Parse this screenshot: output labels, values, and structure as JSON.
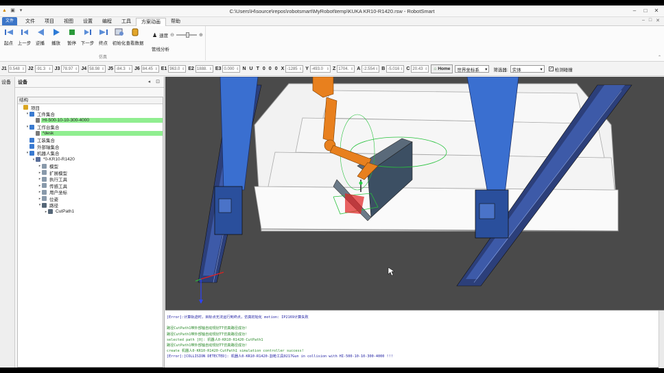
{
  "window": {
    "title": "C:\\Users\\H\\source\\repos\\robotsmart\\MyRobot\\temp\\KUKA KR10-R1420.rsw - RobotSmart",
    "controls": [
      "–",
      "□",
      "✕"
    ],
    "ribbon_controls": [
      "–",
      "□",
      "✕"
    ]
  },
  "menu": {
    "app_button": "文件",
    "items": [
      "文件",
      "项目",
      "视图",
      "设置",
      "编程",
      "工具",
      "方案动画",
      "帮助"
    ],
    "active_index": 6
  },
  "ribbon": {
    "buttons": [
      {
        "label": "起点",
        "icon": "skip-start-icon"
      },
      {
        "label": "上一步",
        "icon": "step-back-icon"
      },
      {
        "label": "逆播",
        "icon": "play-reverse-icon"
      },
      {
        "label": "播放",
        "icon": "play-icon"
      },
      {
        "label": "暂停",
        "icon": "pause-icon"
      },
      {
        "label": "下一步",
        "icon": "step-forward-icon"
      },
      {
        "label": "终点",
        "icon": "skip-end-icon"
      },
      {
        "label": "初始化",
        "icon": "initialize-icon"
      },
      {
        "label": "查看数据",
        "icon": "database-icon"
      }
    ],
    "speed_label": "速度",
    "speed_level": 0.5,
    "trajectory_label": "管线分析",
    "group_title": "仿真"
  },
  "joints": [
    {
      "label": "J1",
      "value": "0.548",
      "w": 26
    },
    {
      "label": "J2",
      "value": "-91.3",
      "w": 26
    },
    {
      "label": "J3",
      "value": "78.97",
      "w": 26
    },
    {
      "label": "J4",
      "value": "58.98",
      "w": 26
    },
    {
      "label": "J5",
      "value": "-84.3",
      "w": 26
    },
    {
      "label": "J6",
      "value": "84.45",
      "w": 26
    },
    {
      "label": "E1",
      "value": "963.0",
      "w": 26
    },
    {
      "label": "E2",
      "value": "1888.",
      "w": 26
    },
    {
      "label": "E3",
      "value": "0.000",
      "w": 26
    }
  ],
  "nuto": [
    "N",
    "U",
    "T",
    "0",
    "0",
    "0"
  ],
  "cartesian": [
    {
      "label": "X",
      "value": "-1285",
      "w": 26
    },
    {
      "label": "Y",
      "value": "-493.0",
      "w": 30
    },
    {
      "label": "Z",
      "value": "1704.",
      "w": 26
    },
    {
      "label": "A",
      "value": "-2.554",
      "w": 26
    },
    {
      "label": "B",
      "value": "-5.016",
      "w": 26
    },
    {
      "label": "C",
      "value": "20.43",
      "w": 26
    }
  ],
  "home_label": "Home",
  "coord_select": "世界坐标系",
  "filter_label": "筛选器:",
  "filter_value": "实体",
  "collision_label": "检测碰撞",
  "collision_checked": true,
  "side_tab": "设备",
  "panel": {
    "title": "设备",
    "tree_header": "结构",
    "tree": [
      {
        "d": 0,
        "ex": "",
        "label": "项目",
        "icon": "project-icon",
        "hl": false
      },
      {
        "d": 1,
        "ex": "▾",
        "label": "工件集合",
        "icon": "workpiece-set-icon",
        "hl": false
      },
      {
        "d": 2,
        "ex": "",
        "label": "HI-500-10-10-300-4000",
        "icon": "part-icon",
        "hl": true
      },
      {
        "d": 1,
        "ex": "▾",
        "label": "工作台集合",
        "icon": "table-set-icon",
        "hl": false
      },
      {
        "d": 2,
        "ex": "",
        "label": "*desk",
        "icon": "part-icon",
        "hl": true
      },
      {
        "d": 1,
        "ex": "",
        "label": "工装集合",
        "icon": "fixture-set-icon",
        "hl": false
      },
      {
        "d": 1,
        "ex": "",
        "label": "外部轴集合",
        "icon": "axis-set-icon",
        "hl": false
      },
      {
        "d": 1,
        "ex": "▾",
        "label": "机器人集合",
        "icon": "robot-set-icon",
        "hl": false
      },
      {
        "d": 2,
        "ex": "▾",
        "label": "*0-KR10-R1420",
        "icon": "robot-icon",
        "hl": false
      },
      {
        "d": 3,
        "ex": "▸",
        "label": "模型",
        "icon": "model-icon",
        "hl": false
      },
      {
        "d": 3,
        "ex": "▸",
        "label": "扩展模型",
        "icon": "ext-model-icon",
        "hl": false
      },
      {
        "d": 3,
        "ex": "▸",
        "label": "执行工具",
        "icon": "tool-icon",
        "hl": false
      },
      {
        "d": 3,
        "ex": "▸",
        "label": "传感工具",
        "icon": "sensor-icon",
        "hl": false
      },
      {
        "d": 3,
        "ex": "▸",
        "label": "用户坐标",
        "icon": "frame-icon",
        "hl": false
      },
      {
        "d": 3,
        "ex": "▸",
        "label": "位姿",
        "icon": "pose-icon",
        "hl": false
      },
      {
        "d": 3,
        "ex": "▾",
        "label": "路径",
        "icon": "path-icon",
        "hl": false
      },
      {
        "d": 4,
        "ex": "▸",
        "label": "CutPath1",
        "icon": "path-item-icon",
        "hl": false
      }
    ]
  },
  "output": {
    "lines": [
      {
        "text": "[Error]:计算轨迹时，目标点无法运行到终点，仿真初始化 motion: IP2169计算失败",
        "color": "#1a1aa0"
      },
      {
        "text": "",
        "color": "#000"
      },
      {
        "text": "路径CutPath1带外部轴自动规划TT仿真路径成功!",
        "color": "#2a8a2a"
      },
      {
        "text": "路径CutPath1带外部轴自动规划TT仿真路径成功!",
        "color": "#2a8a2a"
      },
      {
        "text": "selected path [0]: 机器人0-KR10-R1420-CutPath1",
        "color": "#2a8a2a"
      },
      {
        "text": "路径CutPath1带外部轴自动规划TT仿真路径成功!",
        "color": "#2a8a2a"
      },
      {
        "text": "create 机器人0-KR10-R1420-CutPath1 simulation controller success!",
        "color": "#2a8a2a"
      },
      {
        "text": "[Error]:[COLLISION DETECTED]: 机器人0-KR10-R1420-割枪工具0217Gun in collision with HI-500-10-10-300-4000 !!!",
        "color": "#1a1aa0"
      }
    ]
  },
  "colors": {
    "accent_tab": "#3c76c8",
    "highlight": "#90ee90",
    "viewport_bg": "#4a4a4a",
    "robot_orange": "#e8801e",
    "gantry_blue": "#3a6fd0"
  }
}
